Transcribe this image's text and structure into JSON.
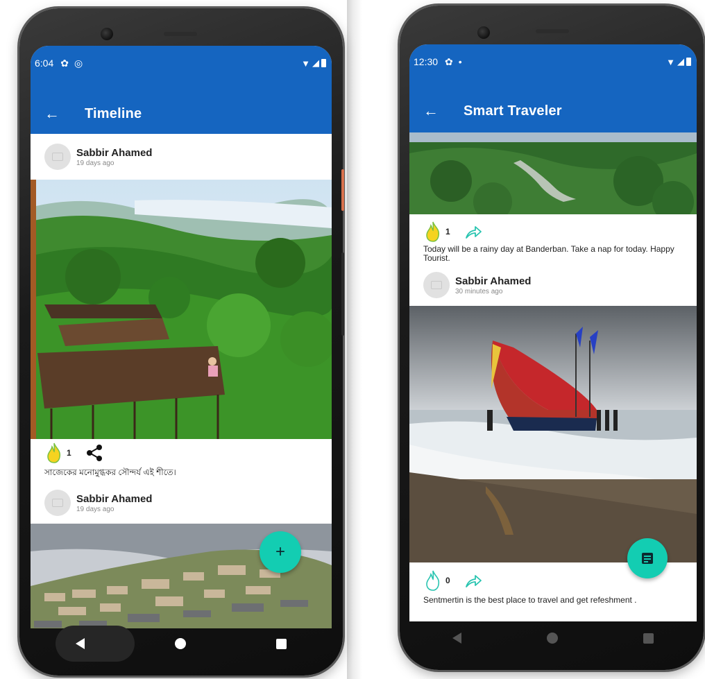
{
  "left_phone": {
    "status": {
      "time": "6:04",
      "icons": [
        "gear-icon",
        "circle-sync-icon"
      ]
    },
    "appbar": {
      "title": "Timeline"
    },
    "posts": [
      {
        "author": "Sabbir Ahamed",
        "ago": "19 days ago",
        "likes": "1",
        "caption": "সাজেকের মনোমুগ্ধকর সৌন্দর্য এই শীতে।"
      },
      {
        "author": "Sabbir Ahamed",
        "ago": "19 days ago"
      }
    ],
    "fab": {
      "label": "+",
      "icon": "add-icon"
    }
  },
  "right_phone": {
    "status": {
      "time": "12:30",
      "icons": [
        "gear-icon",
        "dot-icon"
      ]
    },
    "appbar": {
      "title": "Smart Traveler"
    },
    "posts": [
      {
        "likes": "1",
        "caption": "Today will be a  rainy day at Banderban. Take a nap for today. Happy Tourist."
      },
      {
        "author": "Sabbir Ahamed",
        "ago": "30 minutes ago",
        "likes": "0",
        "caption": "Sentmertin is the best place to travel and get refeshment ."
      }
    ],
    "fab": {
      "icon": "note-icon"
    }
  },
  "colors": {
    "appbar": "#1565c0",
    "fab": "#13cdb2",
    "flame": "#f5d320"
  }
}
